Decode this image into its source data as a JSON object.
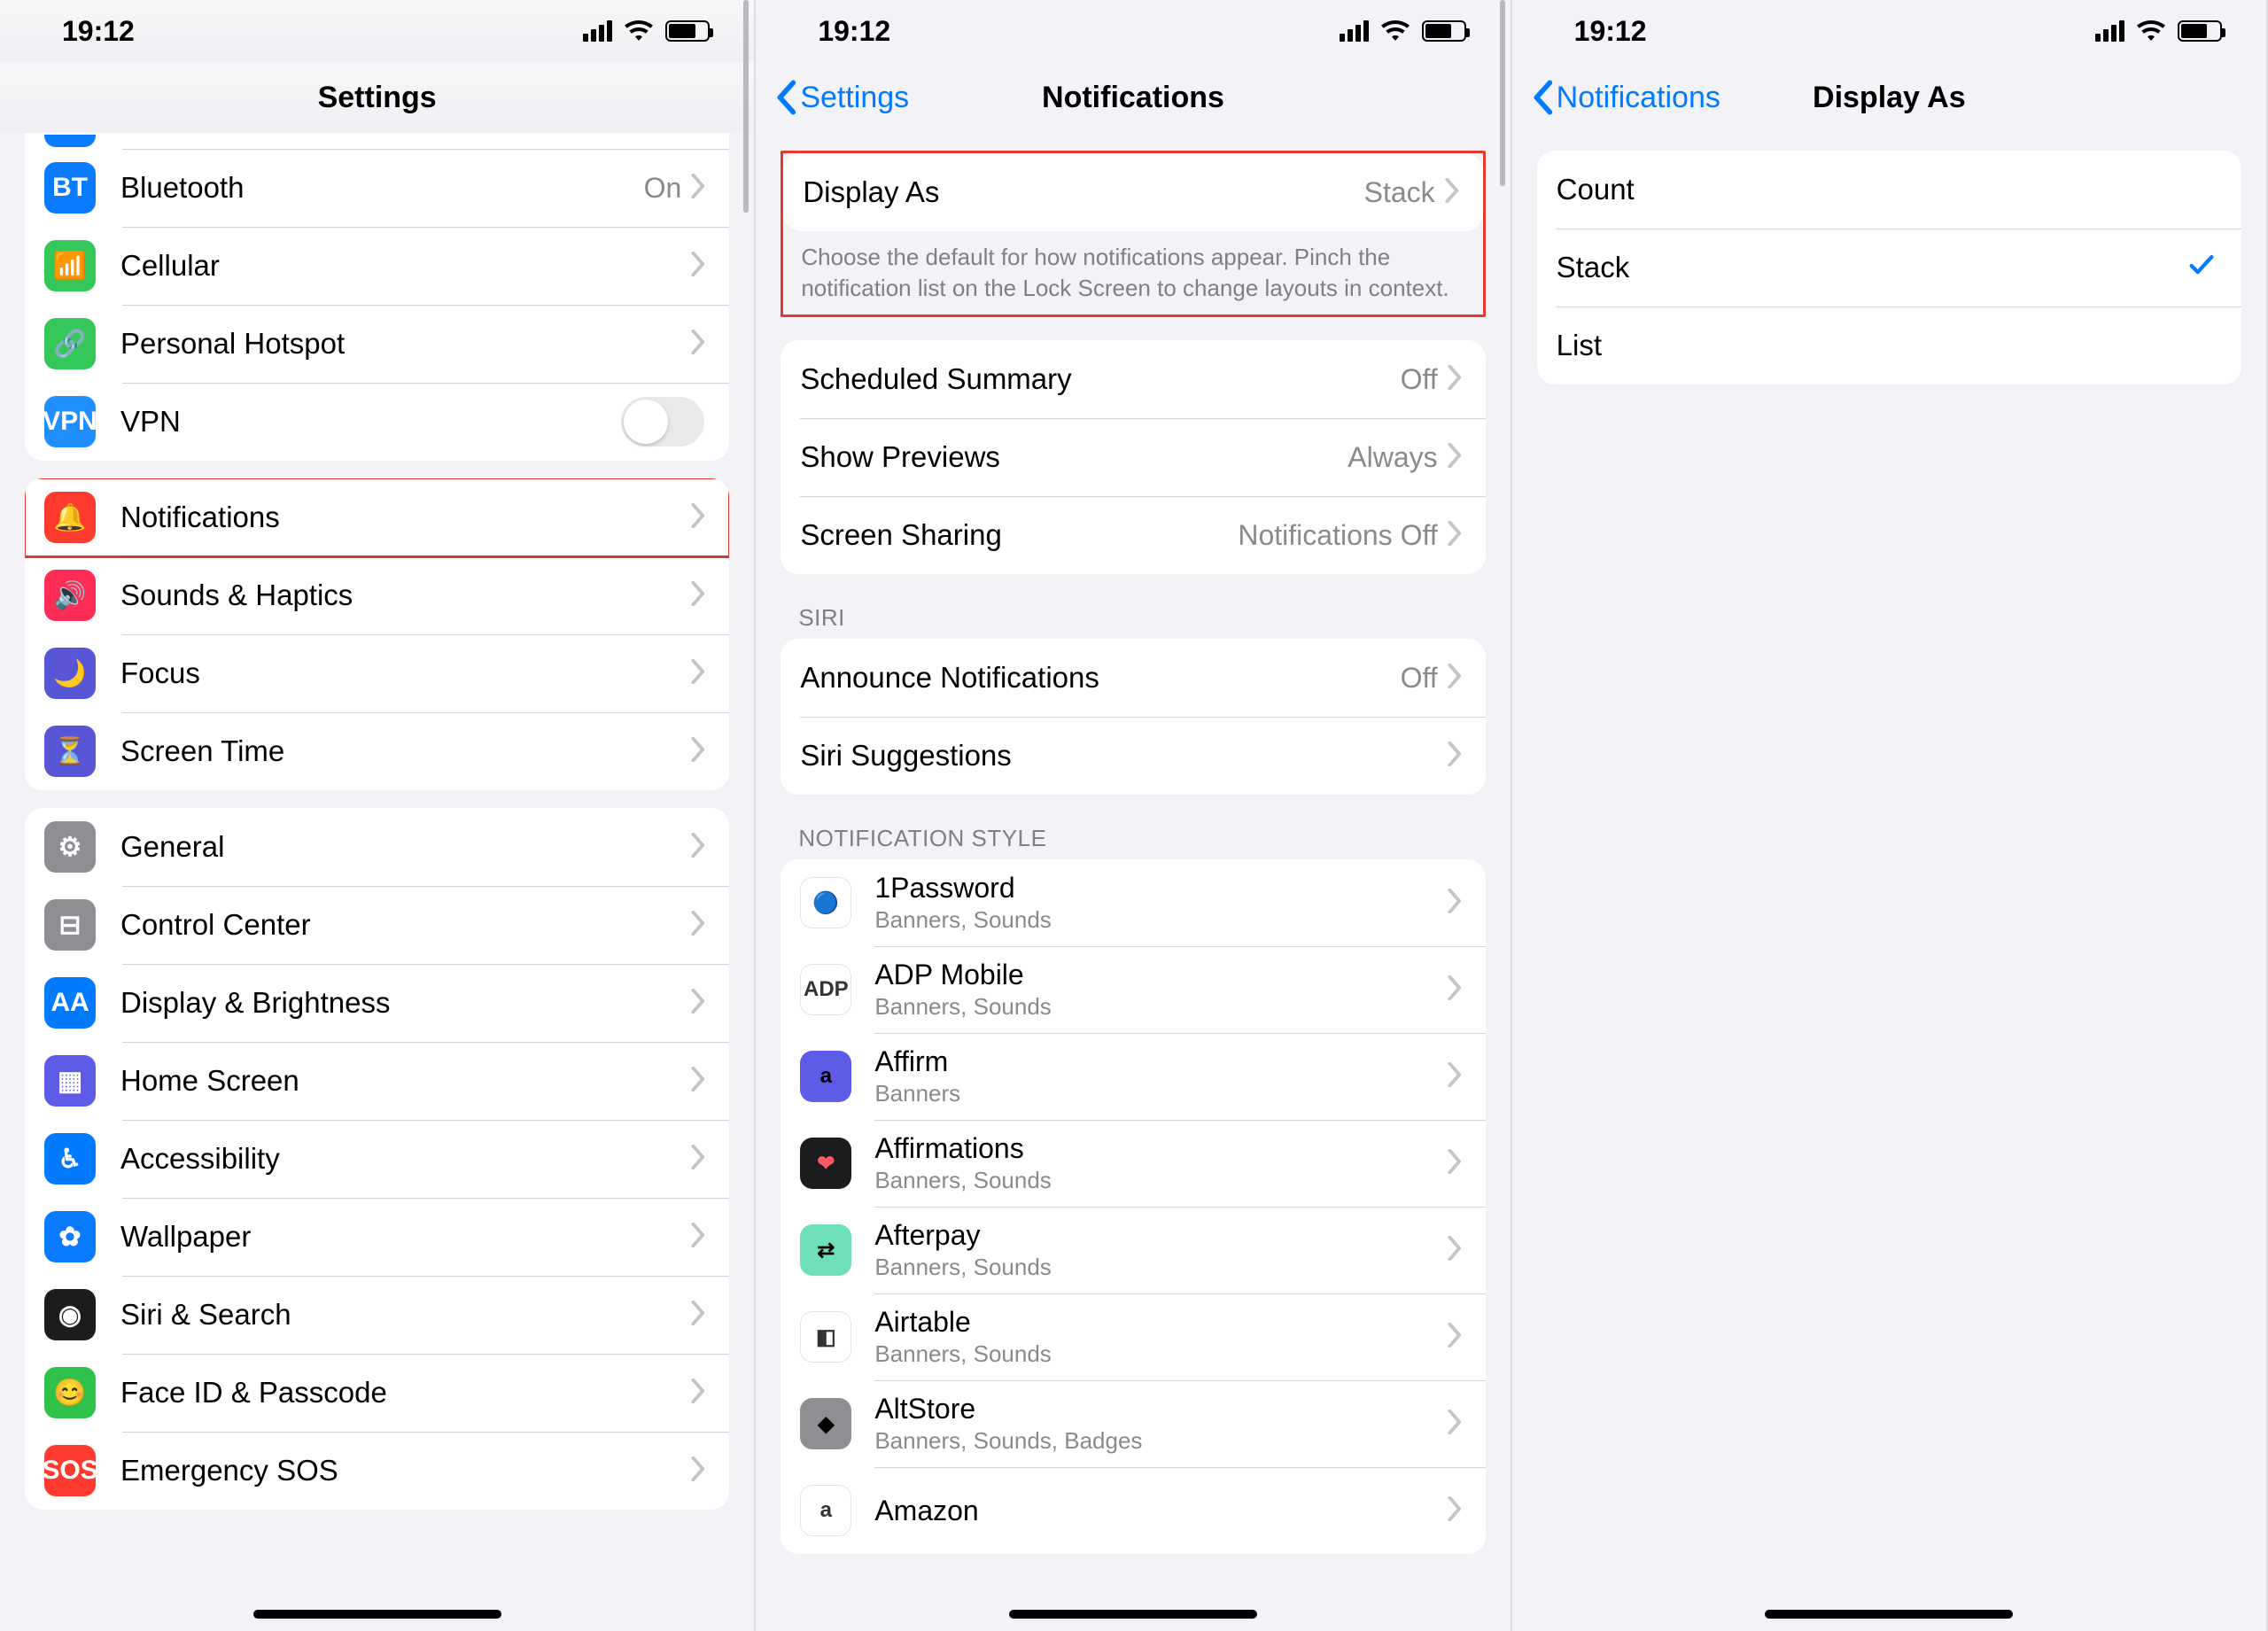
{
  "status": {
    "time": "19:12"
  },
  "screen1": {
    "title": "Settings",
    "partial_row_html": " ",
    "rows_a": [
      {
        "name": "bluetooth",
        "label": "Bluetooth",
        "detail": "On",
        "iconClass": "ic-blue",
        "glyph": "BT"
      },
      {
        "name": "cellular",
        "label": "Cellular",
        "detail": "",
        "iconClass": "ic-green",
        "glyph": "📶"
      },
      {
        "name": "personal-hotspot",
        "label": "Personal Hotspot",
        "detail": "",
        "iconClass": "ic-green",
        "glyph": "🔗"
      },
      {
        "name": "vpn",
        "label": "VPN",
        "detail": "",
        "iconClass": "ic-vpn",
        "glyph": "VPN",
        "toggle": true
      }
    ],
    "rows_b": [
      {
        "name": "notifications",
        "label": "Notifications",
        "detail": "",
        "iconClass": "ic-red",
        "glyph": "🔔",
        "highlight": true
      },
      {
        "name": "sounds-haptics",
        "label": "Sounds & Haptics",
        "detail": "",
        "iconClass": "ic-pink",
        "glyph": "🔊"
      },
      {
        "name": "focus",
        "label": "Focus",
        "detail": "",
        "iconClass": "ic-purple",
        "glyph": "🌙"
      },
      {
        "name": "screen-time",
        "label": "Screen Time",
        "detail": "",
        "iconClass": "ic-purple",
        "glyph": "⏳"
      }
    ],
    "rows_c": [
      {
        "name": "general",
        "label": "General",
        "iconClass": "ic-grey",
        "glyph": "⚙︎"
      },
      {
        "name": "control-center",
        "label": "Control Center",
        "iconClass": "ic-grey",
        "glyph": "⊟"
      },
      {
        "name": "display-brightness",
        "label": "Display & Brightness",
        "iconClass": "ic-blue2",
        "glyph": "AA"
      },
      {
        "name": "home-screen",
        "label": "Home Screen",
        "iconClass": "ic-indigo",
        "glyph": "▦"
      },
      {
        "name": "accessibility",
        "label": "Accessibility",
        "iconClass": "ic-blue2",
        "glyph": "♿︎"
      },
      {
        "name": "wallpaper",
        "label": "Wallpaper",
        "iconClass": "ic-blue",
        "glyph": "✿"
      },
      {
        "name": "siri-search",
        "label": "Siri & Search",
        "iconClass": "ic-black",
        "glyph": "◉"
      },
      {
        "name": "faceid-passcode",
        "label": "Face ID & Passcode",
        "iconClass": "ic-green2",
        "glyph": "😊"
      },
      {
        "name": "emergency-sos",
        "label": "Emergency SOS",
        "iconClass": "ic-sos",
        "glyph": "SOS"
      }
    ]
  },
  "screen2": {
    "back": "Settings",
    "title": "Notifications",
    "display_as": {
      "label": "Display As",
      "value": "Stack"
    },
    "footer1": "Choose the default for how notifications appear. Pinch the notification list on the Lock Screen to change layouts in context.",
    "rows_a": [
      {
        "name": "scheduled-summary",
        "label": "Scheduled Summary",
        "detail": "Off"
      },
      {
        "name": "show-previews",
        "label": "Show Previews",
        "detail": "Always"
      },
      {
        "name": "screen-sharing",
        "label": "Screen Sharing",
        "detail": "Notifications Off"
      }
    ],
    "siri_header": "SIRI",
    "rows_b": [
      {
        "name": "announce-notifications",
        "label": "Announce Notifications",
        "detail": "Off"
      },
      {
        "name": "siri-suggestions",
        "label": "Siri Suggestions",
        "detail": ""
      }
    ],
    "style_header": "NOTIFICATION STYLE",
    "apps": [
      {
        "name": "1password",
        "label": "1Password",
        "sub": "Banners, Sounds",
        "iconClass": "ic-white",
        "glyph": "🔵"
      },
      {
        "name": "adp-mobile",
        "label": "ADP Mobile",
        "sub": "Banners, Sounds",
        "iconClass": "ic-white",
        "glyph": "ADP"
      },
      {
        "name": "affirm",
        "label": "Affirm",
        "sub": "Banners",
        "iconClass": "ic-indigo",
        "glyph": "a"
      },
      {
        "name": "affirmations",
        "label": "Affirmations",
        "sub": "Banners, Sounds",
        "iconClass": "ic-black",
        "glyph": "❤"
      },
      {
        "name": "afterpay",
        "label": "Afterpay",
        "sub": "Banners, Sounds",
        "iconClass": "ic-mint",
        "glyph": "⇄"
      },
      {
        "name": "airtable",
        "label": "Airtable",
        "sub": "Banners, Sounds",
        "iconClass": "ic-white",
        "glyph": "◧"
      },
      {
        "name": "altstore",
        "label": "AltStore",
        "sub": "Banners, Sounds, Badges",
        "iconClass": "ic-grey",
        "glyph": "◆"
      },
      {
        "name": "amazon",
        "label": "Amazon",
        "sub": "",
        "iconClass": "ic-white",
        "glyph": "a"
      }
    ]
  },
  "screen3": {
    "back": "Notifications",
    "title": "Display As",
    "options": [
      {
        "name": "count",
        "label": "Count",
        "selected": false
      },
      {
        "name": "stack",
        "label": "Stack",
        "selected": true
      },
      {
        "name": "list",
        "label": "List",
        "selected": false
      }
    ]
  }
}
